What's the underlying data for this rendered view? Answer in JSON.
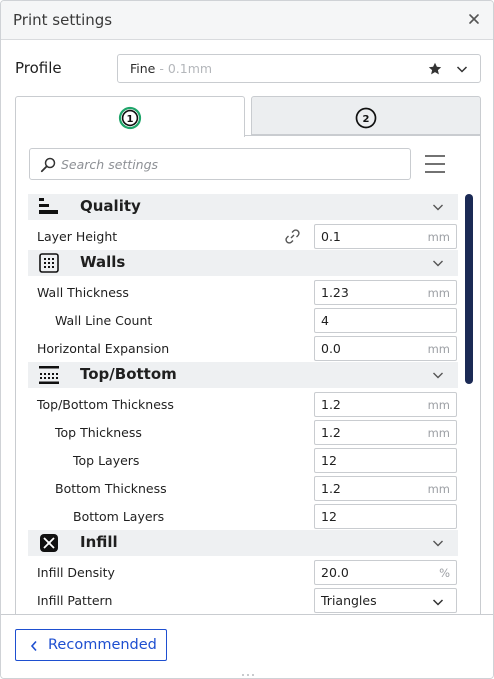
{
  "window": {
    "title": "Print settings",
    "close_icon": "close-icon"
  },
  "profile": {
    "label": "Profile",
    "name": "Fine",
    "subtitle": " - 0.1mm",
    "star_icon": "star-icon",
    "dropdown_icon": "chevron-down-icon"
  },
  "tabs": [
    {
      "label": "1",
      "icon": "badge-1-icon",
      "selected": true
    },
    {
      "label": "2",
      "icon": "badge-2-icon",
      "selected": false
    }
  ],
  "search": {
    "placeholder": "Search settings",
    "icon": "search-icon",
    "menu_icon": "hamburger-menu-icon"
  },
  "categories": {
    "quality": {
      "title": "Quality",
      "rows": {
        "layer_height": {
          "label": "Layer Height",
          "value": "0.1",
          "unit": "mm"
        }
      }
    },
    "walls": {
      "title": "Walls",
      "rows": {
        "wall_thickness": {
          "label": "Wall Thickness",
          "value": "1.23",
          "unit": "mm"
        },
        "wall_line_count": {
          "label": "Wall Line Count",
          "value": "4"
        },
        "horizontal_expansion": {
          "label": "Horizontal Expansion",
          "value": "0.0",
          "unit": "mm"
        }
      }
    },
    "topbottom": {
      "title": "Top/Bottom",
      "rows": {
        "topbottom_thickness": {
          "label": "Top/Bottom Thickness",
          "value": "1.2",
          "unit": "mm"
        },
        "top_thickness": {
          "label": "Top Thickness",
          "value": "1.2",
          "unit": "mm"
        },
        "top_layers": {
          "label": "Top Layers",
          "value": "12"
        },
        "bottom_thickness": {
          "label": "Bottom Thickness",
          "value": "1.2",
          "unit": "mm"
        },
        "bottom_layers": {
          "label": "Bottom Layers",
          "value": "12"
        }
      }
    },
    "infill": {
      "title": "Infill",
      "rows": {
        "infill_density": {
          "label": "Infill Density",
          "value": "20.0",
          "unit": "%"
        },
        "infill_pattern": {
          "label": "Infill Pattern",
          "value": "Triangles"
        }
      }
    }
  },
  "footer": {
    "recommended_label": "Recommended"
  },
  "colors": {
    "accent": "#1e4fd0",
    "scrollbar": "#1b2a55",
    "badge_green": "#1fa56a",
    "category_bg": "#eef0f2"
  }
}
